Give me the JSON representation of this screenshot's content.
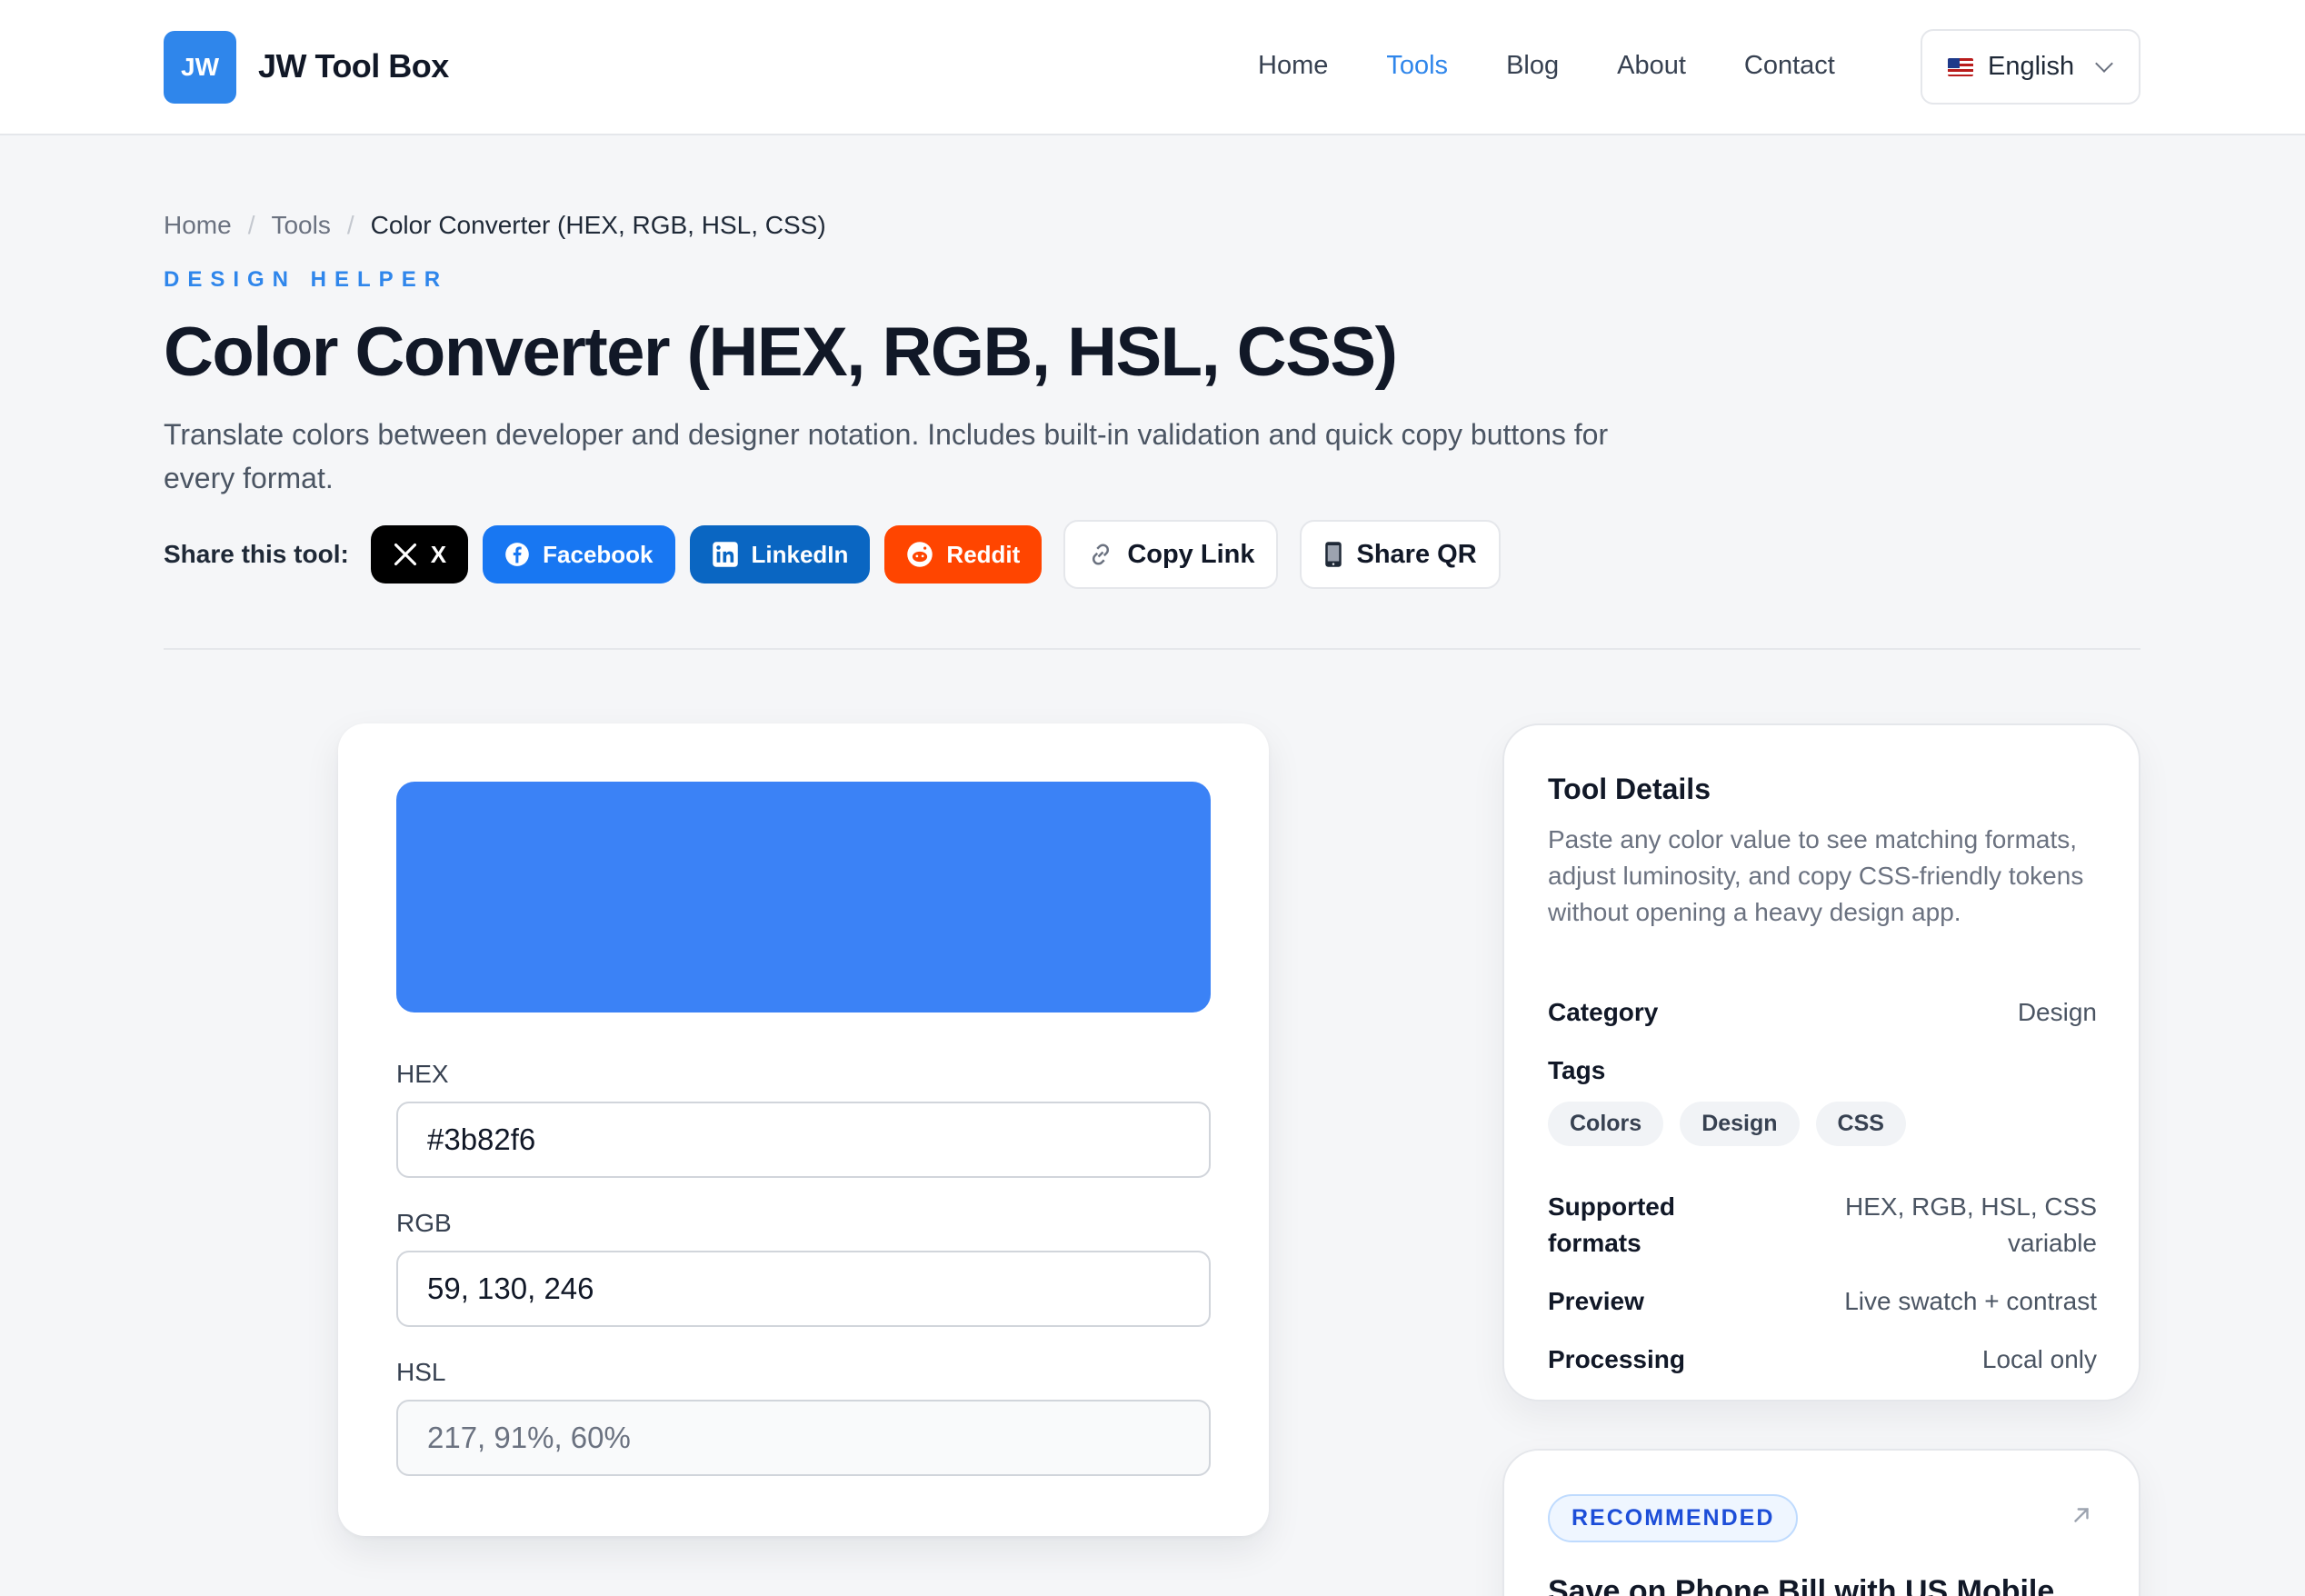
{
  "header": {
    "logo_text": "JW",
    "brand": "JW Tool Box",
    "nav": [
      "Home",
      "Tools",
      "Blog",
      "About",
      "Contact"
    ],
    "nav_active": "Tools",
    "language": "English",
    "accent_color": "#2f86eb"
  },
  "breadcrumb": {
    "items": [
      "Home",
      "Tools"
    ],
    "current": "Color Converter (HEX, RGB, HSL, CSS)",
    "separator": "/"
  },
  "hero": {
    "eyebrow": "DESIGN HELPER",
    "title": "Color Converter (HEX, RGB, HSL, CSS)",
    "description": "Translate colors between developer and designer notation. Includes built-in validation and quick copy buttons for every format."
  },
  "share": {
    "label": "Share this tool:",
    "x": "X",
    "facebook": "Facebook",
    "linkedin": "LinkedIn",
    "reddit": "Reddit",
    "copy_link": "Copy Link",
    "share_qr": "Share QR"
  },
  "converter": {
    "swatch_color": "#3b82f6",
    "hex_label": "HEX",
    "hex_value": "#3b82f6",
    "rgb_label": "RGB",
    "rgb_value": "59, 130, 246",
    "hsl_label": "HSL",
    "hsl_value": "217, 91%, 60%"
  },
  "details": {
    "title": "Tool Details",
    "description": "Paste any color value to see matching formats, adjust luminosity, and copy CSS-friendly tokens without opening a heavy design app.",
    "category_label": "Category",
    "category_value": "Design",
    "tags_label": "Tags",
    "tags": [
      "Colors",
      "Design",
      "CSS"
    ],
    "formats_label": "Supported formats",
    "formats_value": "HEX, RGB, HSL, CSS variable",
    "preview_label": "Preview",
    "preview_value": "Live swatch + contrast",
    "processing_label": "Processing",
    "processing_value": "Local only"
  },
  "recommended": {
    "badge": "RECOMMENDED",
    "title": "Save on Phone Bill with US Mobile"
  }
}
